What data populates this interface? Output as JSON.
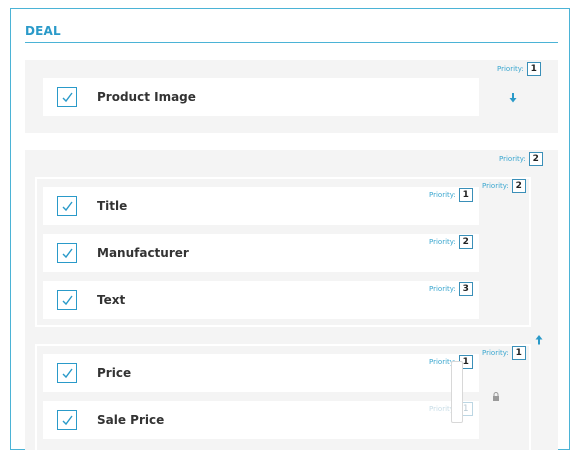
{
  "section": {
    "title": "DEAL"
  },
  "priority_label": "Priority:",
  "groups": [
    {
      "priority": "1",
      "items": [
        {
          "label": "Product Image",
          "checked": true
        }
      ]
    },
    {
      "priority": "2",
      "subgroups": [
        {
          "priority": "2",
          "items": [
            {
              "label": "Title",
              "checked": true,
              "priority": "1"
            },
            {
              "label": "Manufacturer",
              "checked": true,
              "priority": "2"
            },
            {
              "label": "Text",
              "checked": true,
              "priority": "3"
            }
          ]
        },
        {
          "priority": "1",
          "items": [
            {
              "label": "Price",
              "checked": true,
              "priority": "1"
            },
            {
              "label": "Sale Price",
              "checked": true,
              "priority": "1"
            }
          ]
        }
      ]
    }
  ],
  "icons": {
    "move_down": "arrow-down-icon",
    "move_up": "arrow-up-icon",
    "lock": "lock-icon",
    "check": "checkmark-icon"
  },
  "colors": {
    "accent": "#2a9ac9",
    "group_bg": "#f4f4f4"
  }
}
